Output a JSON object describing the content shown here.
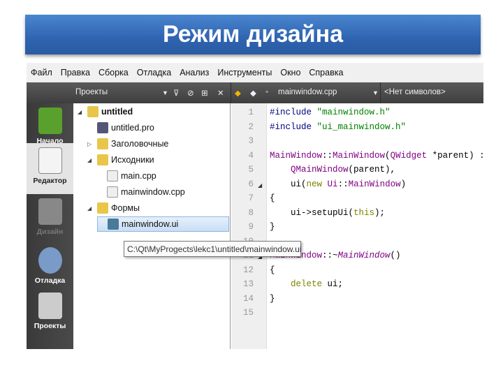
{
  "slide_title": "Режим дизайна",
  "menu": [
    "Файл",
    "Правка",
    "Сборка",
    "Отладка",
    "Анализ",
    "Инструменты",
    "Окно",
    "Справка"
  ],
  "toolbar": {
    "projects_combo": "Проекты",
    "file_combo": "mainwindow.cpp",
    "symbols_combo": "<Нет символов>"
  },
  "modes": [
    {
      "label": "Начало",
      "icon": "qt-logo-icon"
    },
    {
      "label": "Редактор",
      "icon": "editor-icon",
      "selected": true
    },
    {
      "label": "Дизайн",
      "icon": "design-icon",
      "disabled": true
    },
    {
      "label": "Отладка",
      "icon": "debug-bug-icon"
    },
    {
      "label": "Проекты",
      "icon": "projects-icon"
    }
  ],
  "tree": [
    {
      "label": "untitled",
      "level": 0,
      "expanded": true,
      "bold": true
    },
    {
      "label": "untitled.pro",
      "level": 1
    },
    {
      "label": "Заголовочные",
      "level": 1,
      "expanded": false
    },
    {
      "label": "Исходники",
      "level": 1,
      "expanded": true
    },
    {
      "label": "main.cpp",
      "level": 2
    },
    {
      "label": "mainwindow.cpp",
      "level": 2
    },
    {
      "label": "Формы",
      "level": 1,
      "expanded": true
    },
    {
      "label": "mainwindow.ui",
      "level": 2,
      "selected": true
    }
  ],
  "tooltip": "C:\\Qt\\MyProgects\\lekc1\\untitled\\mainwindow.ui",
  "line_numbers": [
    "1",
    "2",
    "3",
    "4",
    "5",
    "6",
    "7",
    "8",
    "9",
    "10",
    "11",
    "12",
    "13",
    "14",
    "15"
  ],
  "code": [
    [
      [
        "pp",
        "#include "
      ],
      [
        "st",
        "\"mainwindow.h\""
      ]
    ],
    [
      [
        "pp",
        "#include "
      ],
      [
        "st",
        "\"ui_mainwindow.h\""
      ]
    ],
    [],
    [
      [
        "ty",
        "MainWindow"
      ],
      [
        "",
        "::"
      ],
      [
        "ty",
        "MainWindow"
      ],
      [
        "",
        "("
      ],
      [
        "ty",
        "QWidget"
      ],
      [
        "",
        " *parent) :"
      ]
    ],
    [
      [
        "",
        "    "
      ],
      [
        "ty",
        "QMainWindow"
      ],
      [
        "",
        "(parent),"
      ]
    ],
    [
      [
        "",
        "    ui("
      ],
      [
        "kw",
        "new"
      ],
      [
        "",
        " "
      ],
      [
        "ty",
        "Ui"
      ],
      [
        "",
        "::"
      ],
      [
        "ty",
        "MainWindow"
      ],
      [
        "",
        ")"
      ]
    ],
    [
      [
        "",
        "{"
      ]
    ],
    [
      [
        "",
        "    ui->setupUi("
      ],
      [
        "kw",
        "this"
      ],
      [
        "",
        ");"
      ]
    ],
    [
      [
        "",
        "}"
      ]
    ],
    [],
    [
      [
        "ty",
        "MainWindow"
      ],
      [
        "",
        "::~"
      ],
      [
        "ty it",
        "MainWindow"
      ],
      [
        "",
        "()"
      ]
    ],
    [
      [
        "",
        "{"
      ]
    ],
    [
      [
        "",
        "    "
      ],
      [
        "kw",
        "delete"
      ],
      [
        "",
        " ui;"
      ]
    ],
    [
      [
        "",
        "}"
      ]
    ],
    []
  ],
  "colors": {
    "banner": "#3a72c0",
    "preprocessor": "#000080",
    "string": "#008000",
    "type": "#800080",
    "keyword": "#808000"
  }
}
